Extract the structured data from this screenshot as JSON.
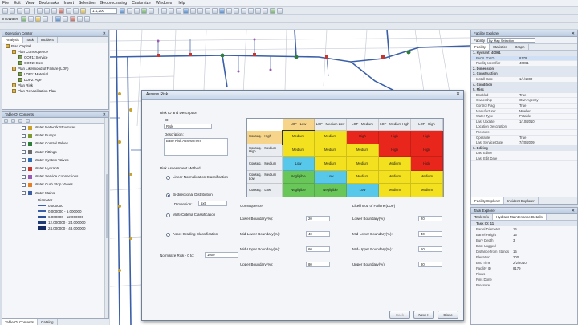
{
  "menu": [
    "File",
    "Edit",
    "View",
    "Bookmarks",
    "Insert",
    "Selection",
    "Geoprocessing",
    "Customize",
    "Windows",
    "Help"
  ],
  "toolbar": {
    "scale": "1:1,200",
    "workspace": "InfoWater"
  },
  "operation_center": {
    "title": "Operation Center",
    "tabs": [
      "Analysis",
      "Task",
      "Incident"
    ],
    "tree": [
      {
        "label": "Plan Capital",
        "level": 0
      },
      {
        "label": "Plan Consequence",
        "level": 1
      },
      {
        "label": "COF1: Service",
        "level": 2
      },
      {
        "label": "COF2: Cost",
        "level": 2
      },
      {
        "label": "Plan Likelihood of Failure (LOF)",
        "level": 1
      },
      {
        "label": "LOF1: Material",
        "level": 2
      },
      {
        "label": "LOF2: Age",
        "level": 2
      },
      {
        "label": "Plan Risk",
        "level": 1
      },
      {
        "label": "Plan Rehabilitation Plan",
        "level": 1
      }
    ]
  },
  "toc": {
    "title": "Table Of Contents",
    "layers": [
      {
        "label": "Water Network Structures",
        "color": "#c9a227"
      },
      {
        "label": "Water Pumps",
        "color": "#7c9a2d"
      },
      {
        "label": "Water Control Valves",
        "color": "#2f7d3a"
      },
      {
        "label": "Water Fittings",
        "color": "#6a6a6a"
      },
      {
        "label": "Water System Valves",
        "color": "#2f6db0"
      },
      {
        "label": "Water Hydrants",
        "color": "#c8372d"
      },
      {
        "label": "Water Service Connections",
        "color": "#9b59b6"
      },
      {
        "label": "Water Curb Stop Valves",
        "color": "#e67e22"
      },
      {
        "label": "Water Mains",
        "color": "#3a5fa8"
      }
    ],
    "legend": [
      "Diameter",
      "0.000000",
      "0.000000 - 6.000000",
      "6.000000 - 12.000000",
      "12.000000 - 24.000000",
      "24.000000 - 48.000000"
    ],
    "bottom_tabs": [
      "Table Of Contents",
      "Catalog"
    ]
  },
  "feature_explorer": {
    "title": "Facility Explorer",
    "selection_label": "Facility",
    "selection_value": "By Map Selection",
    "tabs": [
      "Facility",
      "Statistics",
      "Graph"
    ],
    "bottom_tabs": [
      "Facility Explorer",
      "Incident Explorer"
    ],
    "rows": [
      {
        "k": "1. Hydrant: 40061",
        "v": "",
        "grp": true
      },
      {
        "k": "FACILITYID",
        "v": "8179"
      },
      {
        "k": "Facility Identifier",
        "v": "40061"
      },
      {
        "k": "2. Dimension",
        "v": "",
        "grp": true
      },
      {
        "k": "3. Construction",
        "v": "",
        "grp": true
      },
      {
        "k": "Install Date",
        "v": "1/1/1980"
      },
      {
        "k": "4. Condition",
        "v": "",
        "grp": true
      },
      {
        "k": "5. Misc",
        "v": "",
        "grp": true
      },
      {
        "k": "Enabled",
        "v": "True"
      },
      {
        "k": "Ownership",
        "v": "Own Agency"
      },
      {
        "k": "Control Flag",
        "v": "True"
      },
      {
        "k": "Manufacturer",
        "v": "Mueller"
      },
      {
        "k": "Water Type",
        "v": "Potable"
      },
      {
        "k": "Last Update",
        "v": "1/10/2010"
      },
      {
        "k": "Location Description",
        "v": ""
      },
      {
        "k": "Pressure",
        "v": ""
      },
      {
        "k": "Operable",
        "v": "True"
      },
      {
        "k": "Last Service Date",
        "v": "7/20/2009"
      },
      {
        "k": "6. Editing",
        "v": "",
        "grp": true
      },
      {
        "k": "Last Editor",
        "v": ""
      },
      {
        "k": "Last Edit Date",
        "v": ""
      }
    ]
  },
  "task_explorer": {
    "title": "Task Explorer",
    "tabs": [
      "Task Info",
      "Hydrant Maintenance Details"
    ],
    "rows": [
      {
        "k": "Task ID: 11",
        "v": "",
        "top": true
      },
      {
        "k": "Barrel Diameter",
        "v": "16"
      },
      {
        "k": "Barrel Height",
        "v": "15"
      },
      {
        "k": "Bury Depth",
        "v": "3"
      },
      {
        "k": "Date Logged",
        "v": ""
      },
      {
        "k": "Distance from Stands",
        "v": "15"
      },
      {
        "k": "Elevation",
        "v": "200"
      },
      {
        "k": "End Time",
        "v": "2/2/2010"
      },
      {
        "k": "Facility ID",
        "v": "8179"
      },
      {
        "k": "Flows",
        "v": ""
      },
      {
        "k": "Pins Done",
        "v": ""
      },
      {
        "k": "Pressure",
        "v": ""
      }
    ]
  },
  "dialog": {
    "title": "Assess Risk",
    "risk_id_label": "Risk ID and Description",
    "id_label": "ID:",
    "id_value": "Risk",
    "desc_label": "Description:",
    "desc_value": "Base Risk Assessment",
    "method_label": "Risk Assessment Method",
    "methods": [
      {
        "label": "Linear Normalization Classification",
        "on": false
      },
      {
        "label": "Bi-directional Distribution",
        "on": true
      },
      {
        "label": "Multi-Criteria Classification",
        "on": false
      },
      {
        "label": "Asset Grading Classification",
        "on": false
      }
    ],
    "dimension_label": "Dimension:",
    "dimension_value": "5x5",
    "normalize_label": "Normalize Risk - 0 to:",
    "normalize_value": "1000",
    "matrix": {
      "col_headers": [
        "LOF - Low",
        "LOF - Medium Low",
        "LOF - Medium",
        "LOF - Medium High",
        "LOF - High"
      ],
      "row_headers": [
        "Conseq. - High",
        "Conseq. - Medium High",
        "Conseq. - Medium",
        "Conseq. - Medium Low",
        "Conseq. - Low"
      ],
      "cells": [
        [
          "Medium",
          "Medium",
          "High",
          "High",
          "High"
        ],
        [
          "Medium",
          "Medium",
          "Medium",
          "High",
          "High"
        ],
        [
          "Low",
          "Medium",
          "Medium",
          "Medium",
          "High"
        ],
        [
          "Negligible",
          "Low",
          "Medium",
          "Medium",
          "Medium"
        ],
        [
          "Negligible",
          "Negligible",
          "Low",
          "Medium",
          "Medium"
        ]
      ],
      "colors": {
        "High": "#e8261c",
        "Medium": "#f3e11f",
        "Low": "#58c8ea",
        "Negligible": "#69c75a"
      }
    },
    "consequence": {
      "label": "Consequence",
      "rows": [
        {
          "label": "Lower Boundary(%):",
          "value": "20"
        },
        {
          "label": "Mid-Lower Boundary(%):",
          "value": "40"
        },
        {
          "label": "Mid-Upper Boundary(%):",
          "value": "60"
        },
        {
          "label": "Upper Boundary(%):",
          "value": "80"
        }
      ]
    },
    "likelihood": {
      "label": "Likelihood of Failure (LOF)",
      "rows": [
        {
          "label": "Lower Boundary(%):",
          "value": "20"
        },
        {
          "label": "Mid-Lower Boundary(%):",
          "value": "40"
        },
        {
          "label": "Mid-Upper Boundary(%):",
          "value": "60"
        },
        {
          "label": "Upper Boundary(%):",
          "value": "80"
        }
      ]
    },
    "buttons": {
      "back": "Back",
      "next": "Next >",
      "close": "Close"
    }
  }
}
